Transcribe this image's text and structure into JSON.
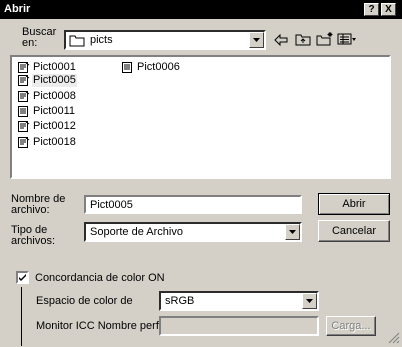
{
  "window": {
    "title": "Abrir",
    "help_label": "?",
    "close_label": "X"
  },
  "lookin": {
    "label_line1": "Buscar",
    "label_line2": "en:",
    "value": "picts"
  },
  "files": [
    {
      "name": "Pict0001"
    },
    {
      "name": "Pict0006"
    },
    {
      "name": "Pict0005",
      "selected": true
    },
    {
      "name": "Pict0008"
    },
    {
      "name": "Pict0011"
    },
    {
      "name": "Pict0012"
    },
    {
      "name": "Pict0018"
    }
  ],
  "filename": {
    "label_line1": "Nombre de",
    "label_line2": "archivo:",
    "value": "Pict0005"
  },
  "filetype": {
    "label_line1": "Tipo de",
    "label_line2": "archivos:",
    "value": "Soporte de Archivo"
  },
  "buttons": {
    "open": "Abrir",
    "cancel": "Cancelar",
    "load": "Carga..."
  },
  "color_match": {
    "checkbox_label": "Concordancia de color ON",
    "checked": true,
    "color_space_label": "Espacio de color de",
    "color_space_value": "sRGB",
    "monitor_label": "Monitor ICC Nombre perfil",
    "monitor_value": ""
  },
  "icons": [
    "back-arrow-icon",
    "up-folder-icon",
    "new-folder-icon",
    "view-menu-icon",
    "folder-icon",
    "file-icon"
  ]
}
